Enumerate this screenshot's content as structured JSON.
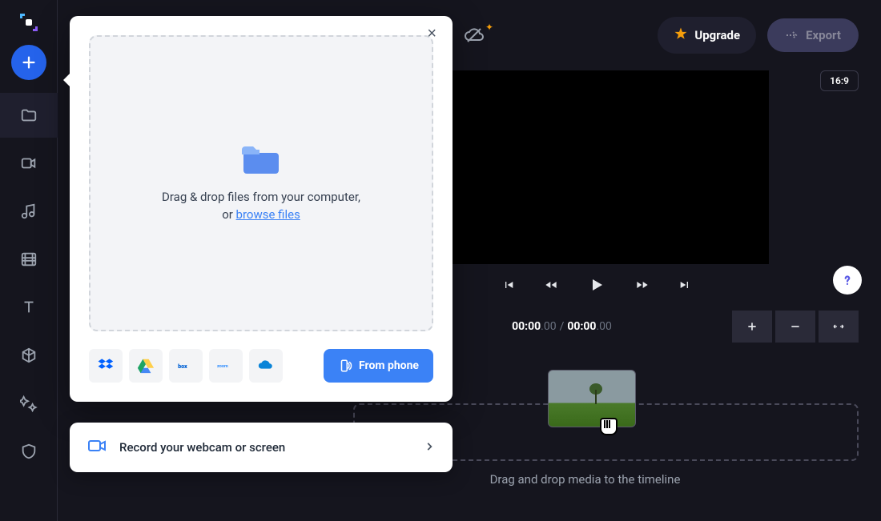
{
  "header": {
    "upgrade": "Upgrade",
    "export": "Export",
    "aspect": "16:9"
  },
  "transport": {
    "time_a": "00:00",
    "time_a_frac": ".00",
    "sep": "/",
    "time_b": "00:00",
    "time_b_frac": ".00"
  },
  "timeline": {
    "hint": "Drag and drop media to the timeline"
  },
  "modal": {
    "drop_text": "Drag & drop files from your computer, or ",
    "browse": "browse files",
    "phone": "From phone",
    "sources": {
      "dropbox": "Dropbox",
      "gdrive": "Google Drive",
      "box": "box",
      "zoom": "zoom",
      "onedrive": "OneDrive"
    }
  },
  "record": {
    "label": "Record your webcam or screen"
  }
}
